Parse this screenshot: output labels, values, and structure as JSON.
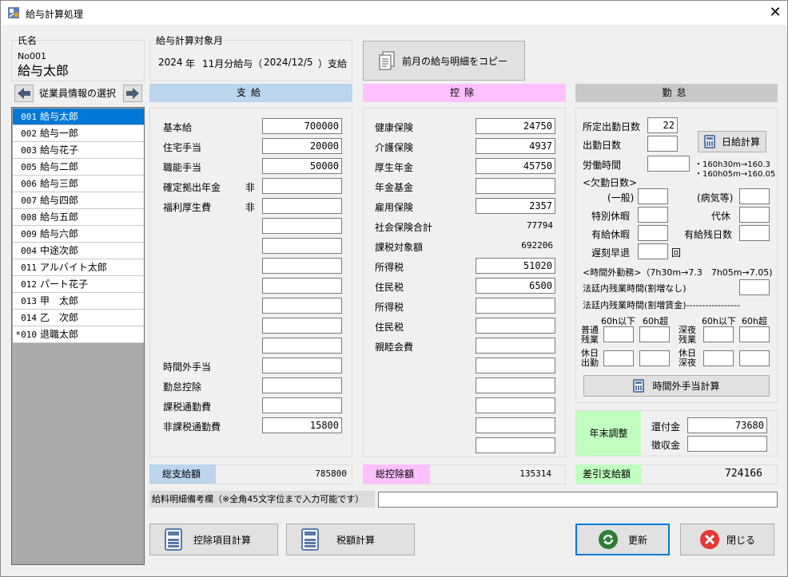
{
  "window": {
    "title": "給与計算処理",
    "close": "✕"
  },
  "employee": {
    "name_label": "氏名",
    "no": "No001",
    "name": "給与太郎",
    "nav_label": "従業員情報の選択"
  },
  "target": {
    "label": "給与計算対象月",
    "year": "2024",
    "nen": "年",
    "month_text": "11月分給与（",
    "date": "2024/12/5",
    "pay_text": "）支給"
  },
  "copy_button": "前月の給与明細をコピー",
  "employees": [
    {
      "code": "001",
      "name": "給与太郎",
      "selected": true
    },
    {
      "code": "002",
      "name": "給与一郎"
    },
    {
      "code": "003",
      "name": "給与花子"
    },
    {
      "code": "005",
      "name": "給与二郎"
    },
    {
      "code": "006",
      "name": "給与三郎"
    },
    {
      "code": "007",
      "name": "給与四郎"
    },
    {
      "code": "008",
      "name": "給与五郎"
    },
    {
      "code": "009",
      "name": "給与六郎"
    },
    {
      "code": "004",
      "name": "中途次郎"
    },
    {
      "code": "011",
      "name": "アルバイト太郎"
    },
    {
      "code": "012",
      "name": "パート花子"
    },
    {
      "code": "013",
      "name": "甲　太郎"
    },
    {
      "code": "014",
      "name": "乙　次郎"
    },
    {
      "code": "*010",
      "name": "退職太郎"
    }
  ],
  "payment": {
    "header": "支給",
    "colors": {
      "header": "#bcd4ec"
    },
    "items": [
      {
        "label": "基本給",
        "hi": "",
        "value": "700000"
      },
      {
        "label": "住宅手当",
        "hi": "",
        "value": "20000"
      },
      {
        "label": "職能手当",
        "hi": "",
        "value": "50000"
      },
      {
        "label": "確定拠出年金",
        "hi": "非",
        "value": ""
      },
      {
        "label": "福利厚生費",
        "hi": "非",
        "value": ""
      },
      {
        "label": "",
        "hi": "",
        "value": ""
      },
      {
        "label": "",
        "hi": "",
        "value": ""
      },
      {
        "label": "",
        "hi": "",
        "value": ""
      },
      {
        "label": "",
        "hi": "",
        "value": ""
      },
      {
        "label": "",
        "hi": "",
        "value": ""
      },
      {
        "label": "",
        "hi": "",
        "value": ""
      },
      {
        "label": "",
        "hi": "",
        "value": ""
      },
      {
        "label": "時間外手当",
        "hi": "",
        "value": ""
      },
      {
        "label": "勤怠控除",
        "hi": "",
        "value": ""
      },
      {
        "label": "課税通勤費",
        "hi": "",
        "value": ""
      },
      {
        "label": "非課税通勤費",
        "hi": "",
        "value": "15800"
      }
    ],
    "total_label": "総支給額",
    "total": "785800"
  },
  "deduction": {
    "header": "控除",
    "colors": {
      "header": "#ffc0ff"
    },
    "items": [
      {
        "label": "健康保険",
        "value": "24750",
        "input": true
      },
      {
        "label": "介護保険",
        "value": "4937",
        "input": true
      },
      {
        "label": "厚生年金",
        "value": "45750",
        "input": true
      },
      {
        "label": "年金基金",
        "value": "",
        "input": true
      },
      {
        "label": "雇用保険",
        "value": "2357",
        "input": true
      },
      {
        "label": "社会保険合計",
        "value": "77794",
        "input": false
      },
      {
        "label": "課税対象額",
        "value": "692206",
        "input": false
      },
      {
        "label": "所得税",
        "value": "51020",
        "input": true
      },
      {
        "label": "住民税",
        "value": "6500",
        "input": true
      },
      {
        "label": "所得税",
        "value": "",
        "input": true
      },
      {
        "label": "住民税",
        "value": "",
        "input": true
      },
      {
        "label": "親睦会費",
        "value": "",
        "input": true
      },
      {
        "label": "",
        "value": "",
        "input": true
      },
      {
        "label": "",
        "value": "",
        "input": true
      },
      {
        "label": "",
        "value": "",
        "input": true
      },
      {
        "label": "",
        "value": "",
        "input": true
      },
      {
        "label": "",
        "value": "",
        "input": true
      }
    ],
    "total_label": "総控除額",
    "total": "135314"
  },
  "attendance": {
    "header": "勤怠",
    "scheduled_days_label": "所定出勤日数",
    "scheduled_days": "22",
    "work_days_label": "出勤日数",
    "work_days": "",
    "daily_calc_button": "日給計算",
    "work_hours_label": "労働時間",
    "work_hours": "",
    "hint1": "・160h30m→160.3",
    "hint2": "・160h05m→160.05",
    "absence_label": "<欠勤日数>",
    "general_label": "(一般)",
    "general": "",
    "sick_label": "(病気等)",
    "sick": "",
    "special_leave_label": "特別休暇",
    "special_leave": "",
    "substitute_label": "代休",
    "substitute": "",
    "paid_leave_label": "有給休暇",
    "paid_leave": "",
    "paid_remaining_label": "有給残日数",
    "paid_remaining": "",
    "late_label": "遅刻早退",
    "late": "",
    "late_unit": "回",
    "overtime_label": "<時間外勤務>（7h30m→7.3　7h05m→7.05)",
    "legal_within_label": "法廷内残業時間(割増なし)",
    "legal_within": "",
    "legal_premium_label": "法廷内残業時間(割増賃金)-----------------",
    "col_60under": "60h以下",
    "col_60over": "60h超",
    "normal_ot_label": "普通残業",
    "late_night_ot_label": "深夜残業",
    "holiday_work_label": "休日出勤",
    "holiday_night_label": "休日深夜",
    "ot_calc_button": "時間外手当計算"
  },
  "year_end": {
    "label": "年末調整",
    "refund_label": "還付金",
    "refund": "73680",
    "collect_label": "徴収金",
    "collect": ""
  },
  "net": {
    "label": "差引支給額",
    "value": "724166"
  },
  "remarks": {
    "label": "給料明細備考欄（※全角45文字位まで入力可能です）",
    "value": ""
  },
  "buttons": {
    "deduction_calc": "控除項目計算",
    "tax_calc": "税額計算",
    "update": "更新",
    "close": "閉じる"
  }
}
